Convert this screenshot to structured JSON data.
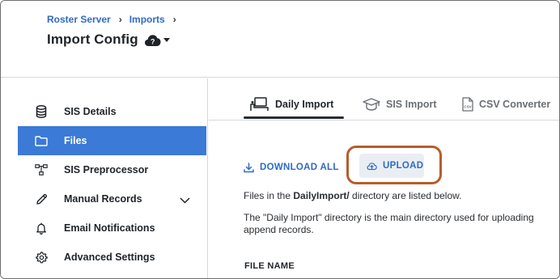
{
  "breadcrumb": {
    "items": [
      "Roster Server",
      "Imports"
    ],
    "separator": "›"
  },
  "header": {
    "title": "Import Config"
  },
  "sidebar": {
    "items": [
      {
        "label": "SIS Details",
        "icon": "database-icon"
      },
      {
        "label": "Files",
        "icon": "folder-icon",
        "active": true
      },
      {
        "label": "SIS Preprocessor",
        "icon": "hierarchy-icon"
      },
      {
        "label": "Manual Records",
        "icon": "pencil-icon",
        "expandable": true
      },
      {
        "label": "Email Notifications",
        "icon": "bell-icon"
      },
      {
        "label": "Advanced Settings",
        "icon": "gear-icon"
      }
    ]
  },
  "tabs": [
    {
      "label": "Daily Import",
      "icon": "desk-icon",
      "active": true
    },
    {
      "label": "SIS Import",
      "icon": "graduation-cap-icon"
    },
    {
      "label": "CSV Converter",
      "icon": "csv-file-icon"
    }
  ],
  "actions": {
    "download_all": "DOWNLOAD ALL",
    "upload": "UPLOAD"
  },
  "content": {
    "desc1_prefix": "Files in the ",
    "desc1_dir": "DailyImport/",
    "desc1_suffix": " directory are listed below.",
    "desc2_line1": "The \"Daily Import\" directory is the main directory used for uploading",
    "desc2_line2": "append records.",
    "column_header": "FILE NAME"
  },
  "colors": {
    "accent": "#3b7ad6",
    "link": "#2e6bc5",
    "highlight": "#b85c2c"
  }
}
